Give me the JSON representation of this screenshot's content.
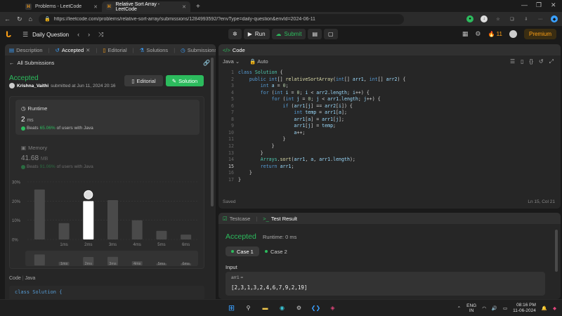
{
  "browser": {
    "tabs": [
      {
        "title": "Problems - LeetCode",
        "active": false
      },
      {
        "title": "Relative Sort Array - LeetCode",
        "active": true
      }
    ],
    "url_host": "leetcode.com",
    "url": "https://leetcode.com/problems/relative-sort-array/submissions/1284993592/?envType=daily-question&envId=2024-06-11"
  },
  "header": {
    "title": "Daily Question",
    "run_label": "Run",
    "submit_label": "Submit",
    "streak": "11",
    "premium_label": "Premium"
  },
  "left_panel": {
    "tabs": [
      {
        "label": "Description"
      },
      {
        "label": "Accepted"
      },
      {
        "label": "Editorial"
      },
      {
        "label": "Solutions"
      },
      {
        "label": "Submissions"
      }
    ],
    "all_submissions": "All Submissions",
    "status": "Accepted",
    "author": "Krishna_Vaithi",
    "submitted_text": "submitted at Jun 11, 2024 20:16",
    "editorial_btn": "Editorial",
    "solution_btn": "Solution",
    "runtime": {
      "label": "Runtime",
      "value": "2",
      "unit": "ms",
      "beats_prefix": "Beats",
      "beats_pct": "65.06%",
      "beats_suffix": "of users with Java"
    },
    "memory": {
      "label": "Memory",
      "value": "41.68",
      "unit": "MB",
      "beats_prefix": "Beats",
      "beats_pct": "91.06%",
      "beats_suffix": "of users with Java"
    },
    "code_label": "Code",
    "code_lang": "Java",
    "code_preview": "class Solution {"
  },
  "chart_data": {
    "type": "bar",
    "categories": [
      "",
      "1ms",
      "2ms",
      "3ms",
      "4ms",
      "5ms",
      "6ms"
    ],
    "values": [
      26,
      8.5,
      20,
      20.5,
      10,
      4.5,
      2.5
    ],
    "highlight_index": 2,
    "ylim": [
      0,
      30
    ],
    "y_ticks": [
      "30%",
      "20%",
      "10%",
      "0%"
    ],
    "minimap_labels": [
      "1ms",
      "2ms",
      "3ms",
      "4ms",
      "5ms",
      "6ms"
    ],
    "colors": {
      "bar": "#4a4a4a",
      "highlight": "#ffffff"
    }
  },
  "editor": {
    "tab_label": "Code",
    "language": "Java",
    "mode": "Auto",
    "saved_label": "Saved",
    "cursor_pos": "Ln 15, Col 21",
    "lines": [
      "1",
      "2",
      "3",
      "4",
      "5",
      "6",
      "7",
      "8",
      "9",
      "10",
      "11",
      "12",
      "13",
      "14",
      "15",
      "16",
      "17"
    ]
  },
  "test_panel": {
    "testcase_tab": "Testcase",
    "result_tab": "Test Result",
    "status": "Accepted",
    "runtime": "Runtime: 0 ms",
    "case1": "Case 1",
    "case2": "Case 2",
    "input_label": "Input",
    "var_name": "arr1 =",
    "var_value": "[2,3,1,3,2,4,6,7,9,2,19]"
  },
  "taskbar": {
    "lang_top": "ENG",
    "lang_bottom": "IN",
    "time": "08:16 PM",
    "date": "11-06-2024"
  }
}
